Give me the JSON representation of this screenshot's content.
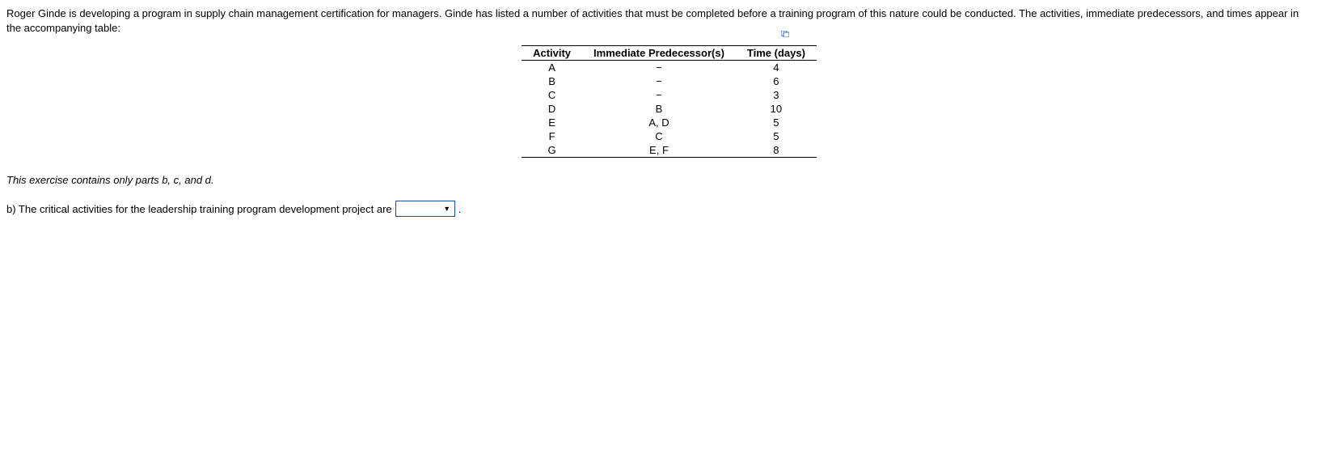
{
  "problem_text": "Roger Ginde is developing a program in supply chain management certification for managers. Ginde has listed a number of activities that must be completed before a training program of this nature could be conducted. The activities, immediate predecessors, and times appear in the accompanying table:",
  "table": {
    "headers": [
      "Activity",
      "Immediate Predecessor(s)",
      "Time (days)"
    ],
    "rows": [
      {
        "activity": "A",
        "predecessors": "−",
        "time": "4"
      },
      {
        "activity": "B",
        "predecessors": "−",
        "time": "6"
      },
      {
        "activity": "C",
        "predecessors": "−",
        "time": "3"
      },
      {
        "activity": "D",
        "predecessors": "B",
        "time": "10"
      },
      {
        "activity": "E",
        "predecessors": "A, D",
        "time": "5"
      },
      {
        "activity": "F",
        "predecessors": "C",
        "time": "5"
      },
      {
        "activity": "G",
        "predecessors": "E, F",
        "time": "8"
      }
    ]
  },
  "parts_note": "This exercise contains only parts b, c, and d.",
  "question_b": {
    "prefix": "b) The critical activities for the leadership training program development project are",
    "suffix": "."
  },
  "icons": {
    "popup": "expand-icon"
  }
}
